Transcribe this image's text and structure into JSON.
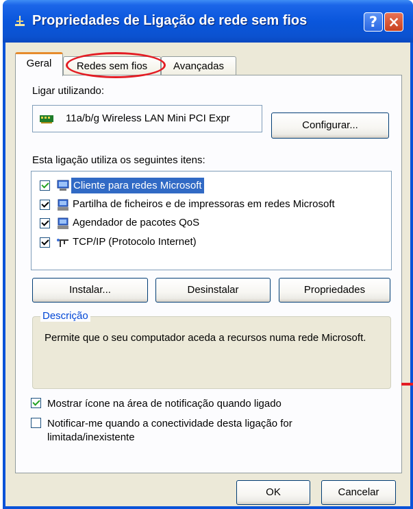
{
  "window": {
    "title": "Propriedades de Ligação de rede sem fios",
    "help_symbol": "?",
    "close_symbol": "×"
  },
  "tabs": [
    {
      "label": "Geral",
      "active": true
    },
    {
      "label": "Redes sem fios",
      "active": false,
      "highlighted": true
    },
    {
      "label": "Avançadas",
      "active": false
    }
  ],
  "general": {
    "connect_using_label": "Ligar utilizando:",
    "adapter_name": "11a/b/g Wireless LAN Mini PCI Expr",
    "configure_label": "Configurar...",
    "items_label": "Esta ligação utiliza os seguintes itens:",
    "items": [
      {
        "label": "Cliente para redes Microsoft",
        "checked": true,
        "selected": true,
        "icon": "network-client-icon"
      },
      {
        "label": "Partilha de ficheiros e de impressoras em redes Microsoft",
        "checked": true,
        "selected": false,
        "icon": "file-printer-sharing-icon"
      },
      {
        "label": "Agendador de pacotes QoS",
        "checked": true,
        "selected": false,
        "icon": "qos-scheduler-icon"
      },
      {
        "label": "TCP/IP (Protocolo Internet)",
        "checked": true,
        "selected": false,
        "icon": "protocol-icon"
      }
    ],
    "install_label": "Instalar...",
    "uninstall_label": "Desinstalar",
    "properties_label": "Propriedades",
    "description_title": "Descrição",
    "description_text": "Permite que o seu computador aceda a recursos numa rede Microsoft.",
    "show_icon_label": "Mostrar ícone na área de notificação quando ligado",
    "show_icon_checked": true,
    "notify_label": "Notificar-me quando a conectividade desta ligação for limitada/inexistente",
    "notify_checked": false
  },
  "footer": {
    "ok_label": "OK",
    "cancel_label": "Cancelar"
  },
  "colors": {
    "titlebar": "#0A56DC",
    "dialog_face": "#ECE9D8",
    "selection": "#316AC5",
    "annotation_circle": "#E31C23",
    "group_title": "#0046D5"
  }
}
